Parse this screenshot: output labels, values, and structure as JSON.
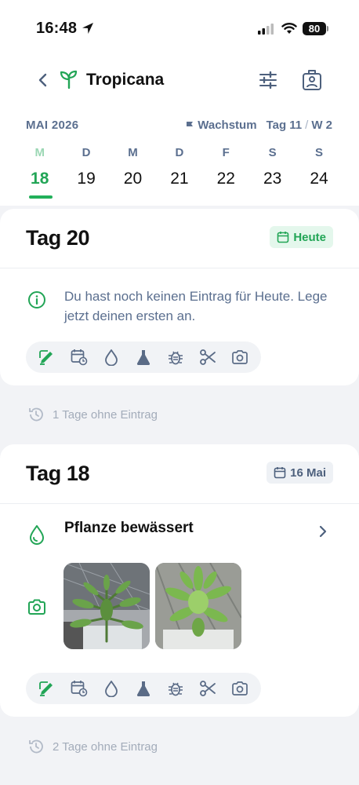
{
  "status_bar": {
    "time": "16:48",
    "battery": "80"
  },
  "header": {
    "title": "Tropicana"
  },
  "calendar": {
    "month": "MAI 2026",
    "phase": "Wachstum",
    "day_label": "Tag 11",
    "week_label": "W 2",
    "separator": "/",
    "days": [
      {
        "dow": "M",
        "num": "18"
      },
      {
        "dow": "D",
        "num": "19"
      },
      {
        "dow": "M",
        "num": "20"
      },
      {
        "dow": "D",
        "num": "21"
      },
      {
        "dow": "F",
        "num": "22"
      },
      {
        "dow": "S",
        "num": "23"
      },
      {
        "dow": "S",
        "num": "24"
      }
    ]
  },
  "today_card": {
    "title": "Tag 20",
    "date_pill": "Heute",
    "info_text": "Du hast noch keinen Eintrag für Heute. Lege jetzt deinen ersten an."
  },
  "gap1": {
    "text": "1 Tage ohne Eintrag"
  },
  "entry_card": {
    "title": "Tag 18",
    "date_pill": "16 Mai",
    "entry_title": "Pflanze bewässert"
  },
  "gap2": {
    "text": "2 Tage ohne Eintrag"
  },
  "actions": [
    "note-edit-icon",
    "calendar-repeat-icon",
    "water-drop-icon",
    "flask-icon",
    "bug-icon",
    "scissors-icon",
    "camera-icon"
  ],
  "colors": {
    "accent": "#22a556",
    "muted": "#5b6f8f",
    "action_icon": "#5a6b86"
  }
}
